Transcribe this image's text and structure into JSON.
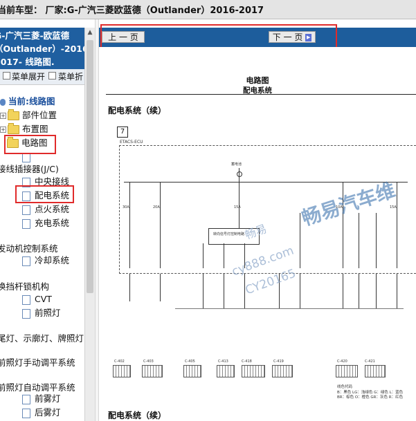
{
  "header": {
    "title": "当前车型：  厂家:G-广汽三菱欧蓝德（Outlander）2016-2017"
  },
  "sidebar": {
    "heading_lines": [
      "G-广汽三菱-欧蓝德",
      "（Outlander）-2016",
      "2017- 线路图."
    ],
    "menu_expand": "菜单展开",
    "menu_collapse": "菜单折",
    "current": "当前:线路图",
    "items": [
      {
        "label": "部件位置"
      },
      {
        "label": "布置图"
      },
      {
        "label": "电路图"
      },
      {
        "label": ""
      },
      {
        "label": "接线插接器(J/C)"
      },
      {
        "label": "中央接线"
      },
      {
        "label": "配电系统"
      },
      {
        "label": "点火系统"
      },
      {
        "label": "充电系统"
      },
      {
        "label": "发动机控制系统"
      },
      {
        "label": "冷却系统"
      },
      {
        "label": "换挡杆锁机构"
      },
      {
        "label": "CVT"
      },
      {
        "label": "前照灯"
      },
      {
        "label": "尾灯、示廓灯、牌照灯"
      },
      {
        "label": "前照灯手动调平系统"
      },
      {
        "label": "前照灯自动调平系统"
      },
      {
        "label": "前雾灯"
      },
      {
        "label": "后雾灯"
      }
    ]
  },
  "nav": {
    "prev_label": "上 一 页",
    "next_label": "下 一 页"
  },
  "document": {
    "title": "电路图",
    "subtitle": "配电系统",
    "section_heading": "配电系统（续）",
    "page_number": "7",
    "unit_label": "ETACS-ECU",
    "fuses": [
      "30A",
      "20A",
      "15A",
      "10A",
      "15A"
    ],
    "module_label": "转向信号灯控制电路",
    "top_label": "蓄电池",
    "connectors": [
      "C-402",
      "C-403",
      "C-405",
      "C-413",
      "C-418",
      "C-419",
      "C-420",
      "C-421"
    ],
    "legend_title": "线色代码",
    "legend_rows": [
      "B：黑色  LG：浅绿色  G：绿色  L：蓝色",
      "BR：棕色  O：橙色  GR：灰色  R：红色"
    ],
    "bottom_heading": "配电系统（续）",
    "watermark_cn": "畅易汽车维",
    "watermark_small": "畅易",
    "watermark_url": "cy888.com",
    "watermark_code": "CY20165"
  }
}
